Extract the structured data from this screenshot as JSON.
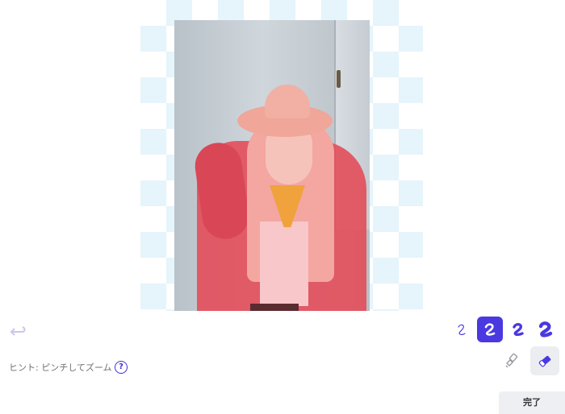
{
  "editor": {
    "hint_text": "ヒント: ピンチしてズーム",
    "help_symbol": "?",
    "done_label": "完了"
  },
  "brush_sizes": [
    {
      "name": "brush-size-small",
      "active": false
    },
    {
      "name": "brush-size-medium",
      "active": true
    },
    {
      "name": "brush-size-large",
      "active": false
    },
    {
      "name": "brush-size-xlarge",
      "active": false
    }
  ],
  "tools": [
    {
      "name": "restore-brush-icon",
      "active": false
    },
    {
      "name": "eraser-icon",
      "active": true
    }
  ],
  "colors": {
    "accent": "#4a39e0",
    "mask_overlay": "#e2505c",
    "checker": "#e6f4fb"
  }
}
